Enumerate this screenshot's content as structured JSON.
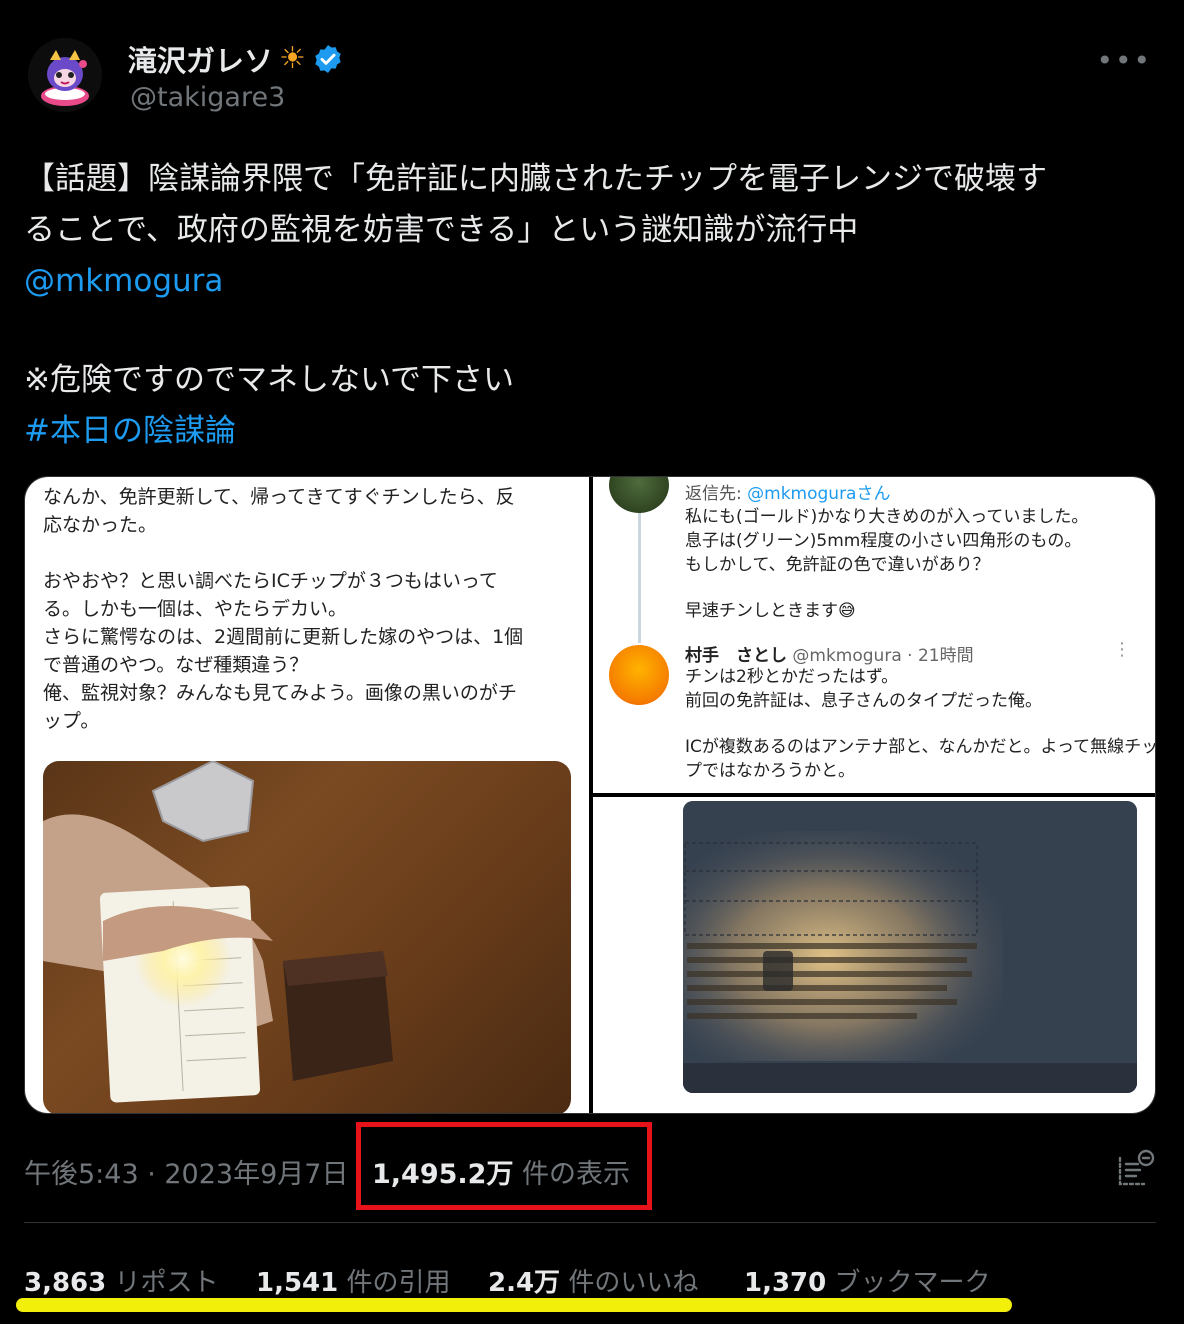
{
  "author": {
    "display_name": "滝沢ガレソ",
    "handle": "@takigare3",
    "verified": true,
    "name_emoji": "sun-icon",
    "avatar": "mascot-avatar"
  },
  "tweet": {
    "lines": [
      "【話題】陰謀論界隈で「免許証に内臓されたチップを電子レンジで破壊す",
      "ることで、政府の監視を妨害できる」という謎知識が流行中"
    ],
    "mention": "@mkmogura",
    "warning": "※危険ですのでマネしないで下さい",
    "hashtag": "#本日の陰謀論"
  },
  "media": {
    "left_text": [
      "なんか、免許更新して、帰ってきてすぐチンしたら、反",
      "応なかった。",
      "",
      "おやおや？と思い調べたらICチップが３つもはいって",
      "る。しかも一個は、やたらデカい。",
      "さらに驚愕なのは、2週間前に更新した嫁のやつは、1個",
      "で普通のやつ。なぜ種類違う？",
      "俺、監視対象？みんなも見てみよう。画像の黒いのがチ",
      "ップ。"
    ],
    "reply_to_label": "返信先: ",
    "reply_to_handle": "@mkmoguraさん",
    "reply1": [
      "私にも(ゴールド)かなり大きめのが入っていました。",
      "息子は(グリーン)5mm程度の小さい四角形のもの。",
      "もしかして、免許証の色で違いがあり？",
      "",
      "早速チンしときます😅"
    ],
    "reply2_name": "村手　さとし",
    "reply2_meta": " @mkmogura · 21時間",
    "reply2": [
      "チンは2秒とかだったはず。",
      "前回の免許証は、息子さんのタイプだった俺。",
      "",
      "ICが複数あるのはアンテナ部と、なんかだと。よって無線チッ",
      "プではなかろうかと。"
    ]
  },
  "meta": {
    "time": "午後5:43 · 2023年9月7日",
    "views_count": "1,495.2万",
    "views_label": " 件の表示"
  },
  "stats": {
    "reposts_count": "3,863",
    "reposts_label": " リポスト",
    "quotes_count": "1,541",
    "quotes_label": " 件の引用",
    "likes_count": "2.4万",
    "likes_label": " 件のいいね",
    "bookmarks_count": "1,370",
    "bookmarks_label": " ブックマーク"
  },
  "colors": {
    "link": "#1d9bf0",
    "muted": "#71767b",
    "highlight_box": "#e8121b",
    "underline": "#f2ef0a"
  }
}
